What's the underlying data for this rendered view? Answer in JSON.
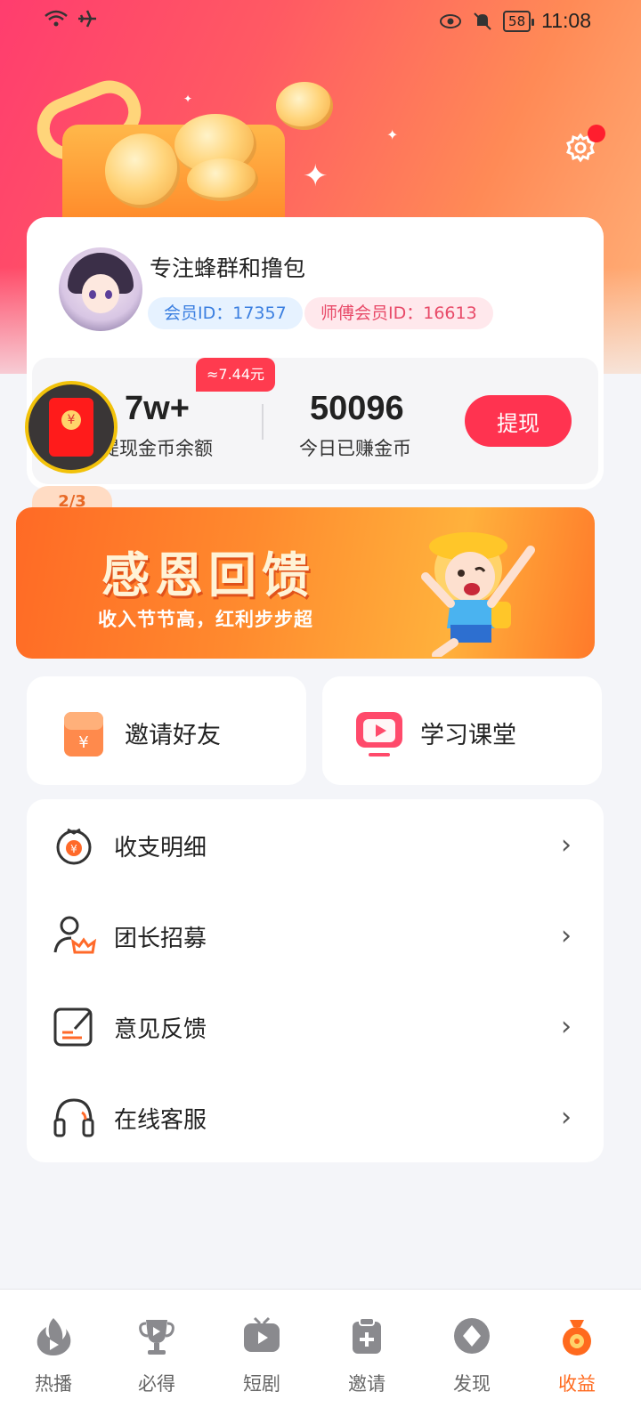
{
  "status_bar": {
    "time": "11:08",
    "battery": "58"
  },
  "profile": {
    "nickname": "专注蜂群和撸包",
    "member_id_label": "会员ID：17357",
    "master_id_label": "师傅会员ID：16613"
  },
  "balance": {
    "estimate_badge": "≈7.44元",
    "withdrawable_value": "7w+",
    "withdrawable_label": "可提现金币余额",
    "today_value": "50096",
    "today_label": "今日已赚金币",
    "withdraw_button": "提现"
  },
  "banner": {
    "page_indicator": "2/3",
    "title": "感恩回馈",
    "subtitle": "收入节节高，红利步步超"
  },
  "quick_actions": [
    {
      "label": "邀请好友",
      "icon": "red-envelope-icon"
    },
    {
      "label": "学习课堂",
      "icon": "video-play-icon"
    }
  ],
  "menu": [
    {
      "label": "收支明细",
      "icon": "money-bag-icon"
    },
    {
      "label": "团长招募",
      "icon": "user-crown-icon"
    },
    {
      "label": "意见反馈",
      "icon": "feedback-edit-icon"
    },
    {
      "label": "在线客服",
      "icon": "headset-icon"
    }
  ],
  "bottom_nav": [
    {
      "label": "热播",
      "icon": "flame-icon"
    },
    {
      "label": "必得",
      "icon": "trophy-icon"
    },
    {
      "label": "短剧",
      "icon": "tv-play-icon"
    },
    {
      "label": "邀请",
      "icon": "clipboard-plus-icon"
    },
    {
      "label": "发现",
      "icon": "compass-icon"
    },
    {
      "label": "收益",
      "icon": "money-pouch-icon",
      "active": true
    }
  ],
  "colors": {
    "accent": "#ff3350",
    "active_tab": "#ff6a1e"
  }
}
